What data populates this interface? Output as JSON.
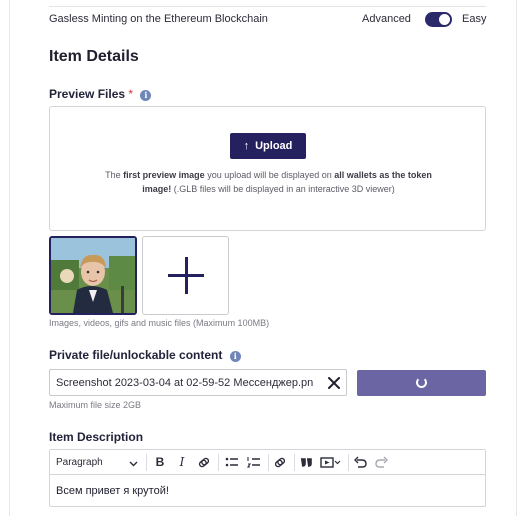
{
  "minting": {
    "title": "Gasless Minting on the Ethereum Blockchain",
    "mode_left": "Advanced",
    "mode_right": "Easy",
    "toggle_on": true
  },
  "section_title": "Item Details",
  "preview": {
    "label": "Preview Files",
    "required_mark": "*",
    "upload_button": "Upload",
    "note_part1": "The ",
    "note_bold1": "first preview image",
    "note_part2": " you upload will be displayed on ",
    "note_bold2": "all wallets as the token image!",
    "note_part3": " (.GLB files will be displayed in an interactive 3D viewer)",
    "file_types_note": "Images, videos, gifs and music files (Maximum 100MB)"
  },
  "private_file": {
    "label": "Private file/unlockable content",
    "file_name": "Screenshot 2023-03-04 at 02-59-52 Мессенджер.pn",
    "size_note": "Maximum file size 2GB"
  },
  "description": {
    "label": "Item Description",
    "block_format": "Paragraph",
    "content": "Всем привет я крутой!"
  },
  "icons": {
    "upload": "upload-arrow-icon",
    "info": "info-icon",
    "clear": "close-icon",
    "spinner": "loading-spinner-icon",
    "add": "plus-icon"
  },
  "colors": {
    "accent": "#25215e",
    "loading_button": "#6b66a3",
    "required": "#d0342c"
  }
}
